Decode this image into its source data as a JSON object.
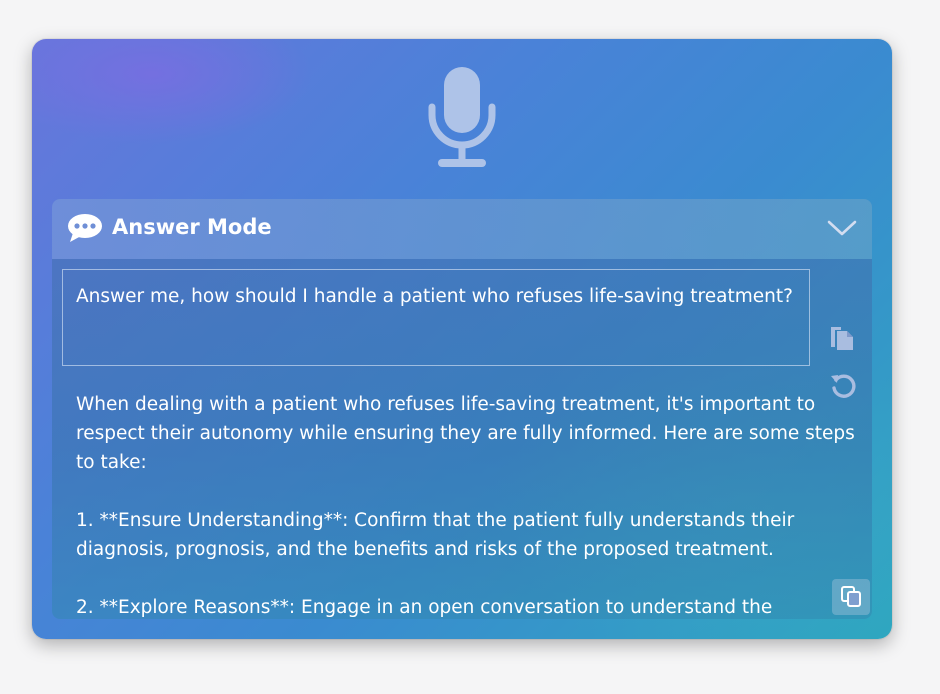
{
  "panel": {
    "title": "Answer Mode",
    "prompt_text": "Answer me, how should I handle a patient who refuses life-saving treatment?"
  },
  "answer": {
    "paragraphs": [
      "When dealing with a patient who refuses life-saving treatment, it's important to respect their autonomy while ensuring they are fully informed. Here are some steps to take:",
      "1. **Ensure Understanding**: Confirm that the patient fully understands their diagnosis, prognosis, and the benefits and risks of the proposed treatment.",
      "2. **Explore Reasons**: Engage in an open conversation to understand the"
    ]
  },
  "icons": {
    "microphone": "microphone-icon",
    "header": "chat-bubble-icon",
    "collapse": "chevron-down-icon",
    "copy_prompt": "copy-icon",
    "regenerate": "refresh-icon",
    "copy_answer": "copy-answer-icon"
  },
  "colors": {
    "text": "#ffffff",
    "icon_muted": "#a9bde0"
  }
}
